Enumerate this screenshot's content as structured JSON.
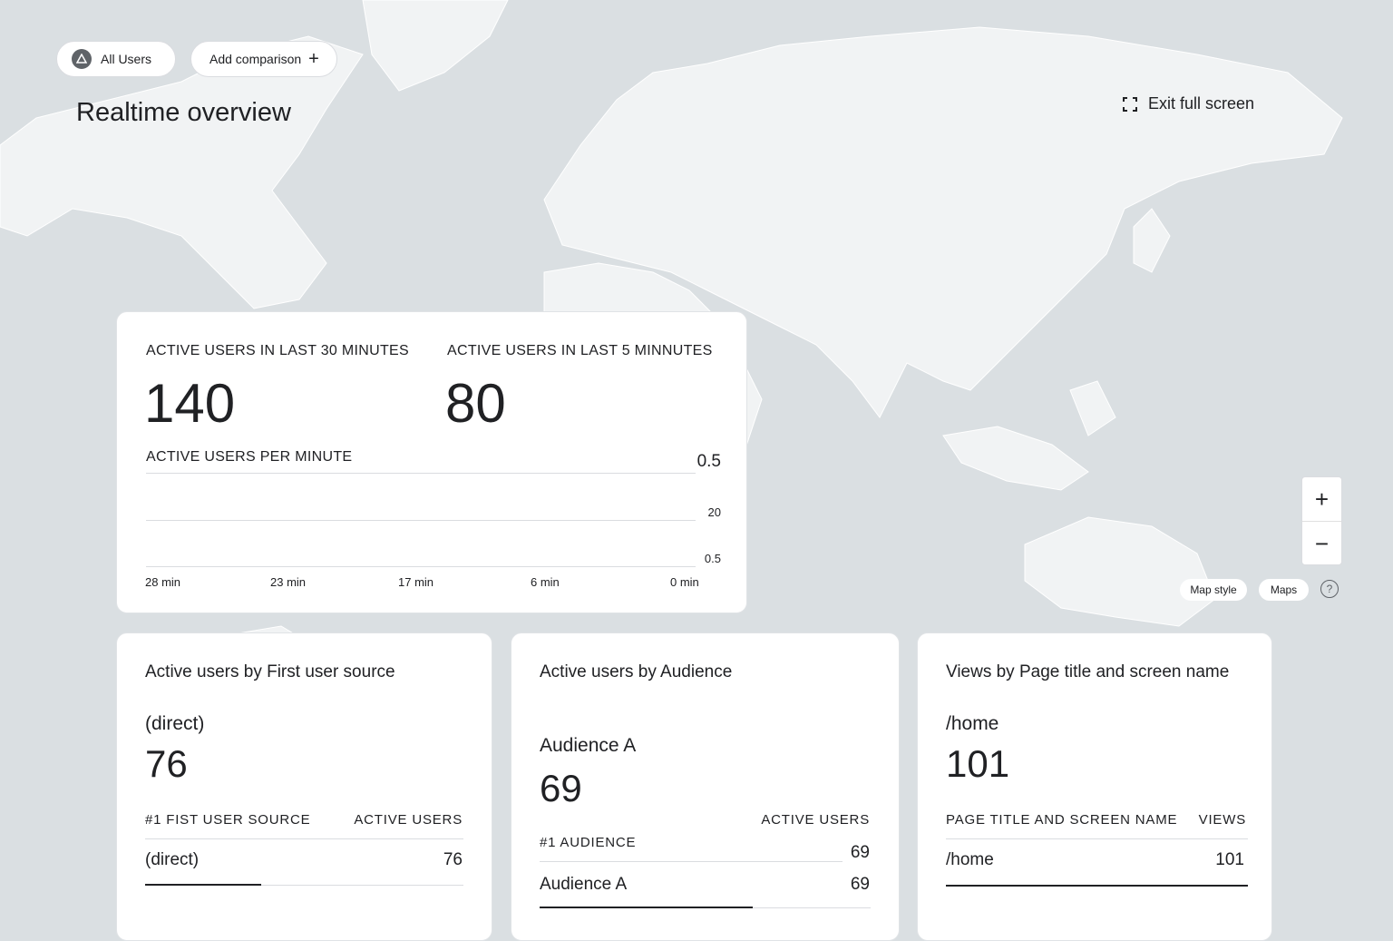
{
  "header": {
    "chip_all_users": "All Users",
    "chip_add_comparison": "Add comparison",
    "title": "Realtime overview",
    "exit_full_screen": "Exit full screen"
  },
  "overview": {
    "metric1_label": "ACTIVE USERS IN LAST 30 MINUTES",
    "metric1_value": "140",
    "metric2_label": "ACTIVE USERS IN LAST 5 MINNUTES",
    "metric2_value": "80",
    "chart_label": "ACTIVE USERS PER MINUTE",
    "y_ticks": [
      "0.5",
      "20",
      "0.5"
    ],
    "x_ticks": [
      "28 min",
      "23 min",
      "17 min",
      "6 min",
      "0 min"
    ]
  },
  "source_card": {
    "title": "Active users by First user source",
    "top_name": "(direct)",
    "top_value": "76",
    "col1": "#1 FIST USER SOURCE",
    "col2": "ACTIVE USERS",
    "rows": [
      {
        "name": "(direct)",
        "value": "76"
      }
    ]
  },
  "audience_card": {
    "title": "Active users by Audience",
    "top_name": "Audience A",
    "top_value": "69",
    "col2": "ACTIVE USERS",
    "col1": "#1 AUDIENCE",
    "col1_value": "69",
    "rows": [
      {
        "name": "Audience A",
        "value": "69"
      }
    ]
  },
  "page_card": {
    "title": "Views by Page title and screen name",
    "top_name": "/home",
    "top_value": "101",
    "col1": "PAGE TITLE AND SCREEN NAME",
    "col2": "VIEWS",
    "rows": [
      {
        "name": "/home",
        "value": "101"
      }
    ]
  },
  "map_controls": {
    "zoom_in": "+",
    "zoom_out": "−",
    "map_style": "Map style",
    "maps": "Maps",
    "help": "?"
  }
}
